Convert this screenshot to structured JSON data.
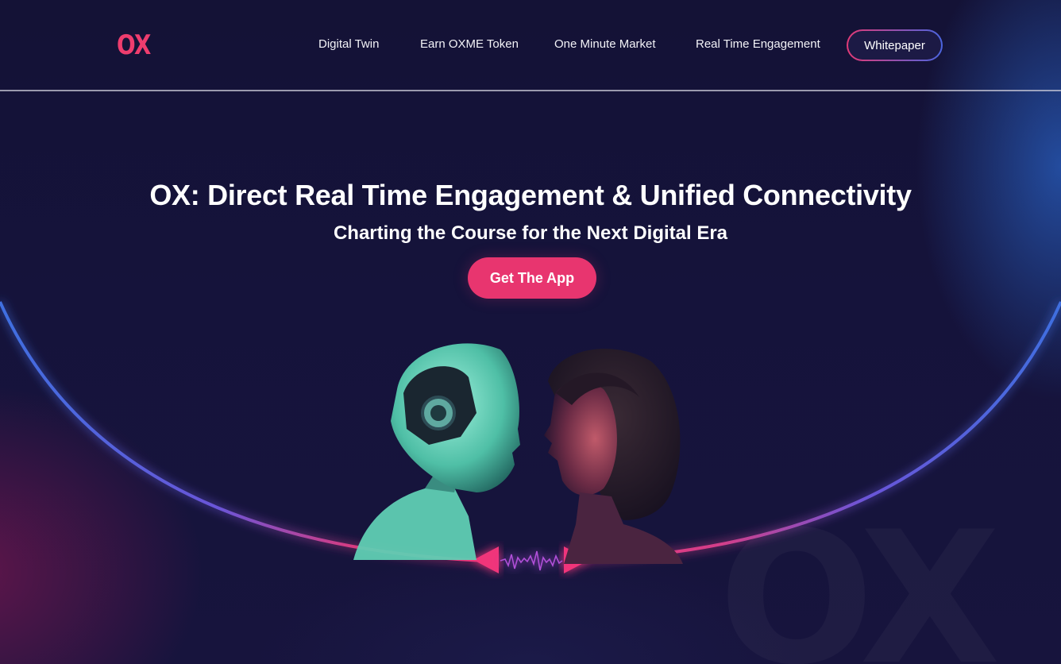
{
  "header": {
    "logo_text": "OX",
    "nav": [
      {
        "label": "Digital Twin"
      },
      {
        "label": "Earn OXME Token"
      },
      {
        "label": "One Minute Market"
      },
      {
        "label": "Real Time Engagement"
      }
    ],
    "whitepaper_label": "Whitepaper"
  },
  "hero": {
    "title": "OX: Direct Real Time Engagement & Unified Connectivity",
    "subtitle": "Charting the Course for the Next Digital Era",
    "cta_label": "Get The App",
    "image": "robot-and-woman-face-to-face-illustration",
    "watermark_text": "OX"
  },
  "colors": {
    "accent": "#e8356f",
    "background": "#16143a",
    "arc_blue": "#3f6fe0",
    "arc_pink": "#f0357a"
  }
}
